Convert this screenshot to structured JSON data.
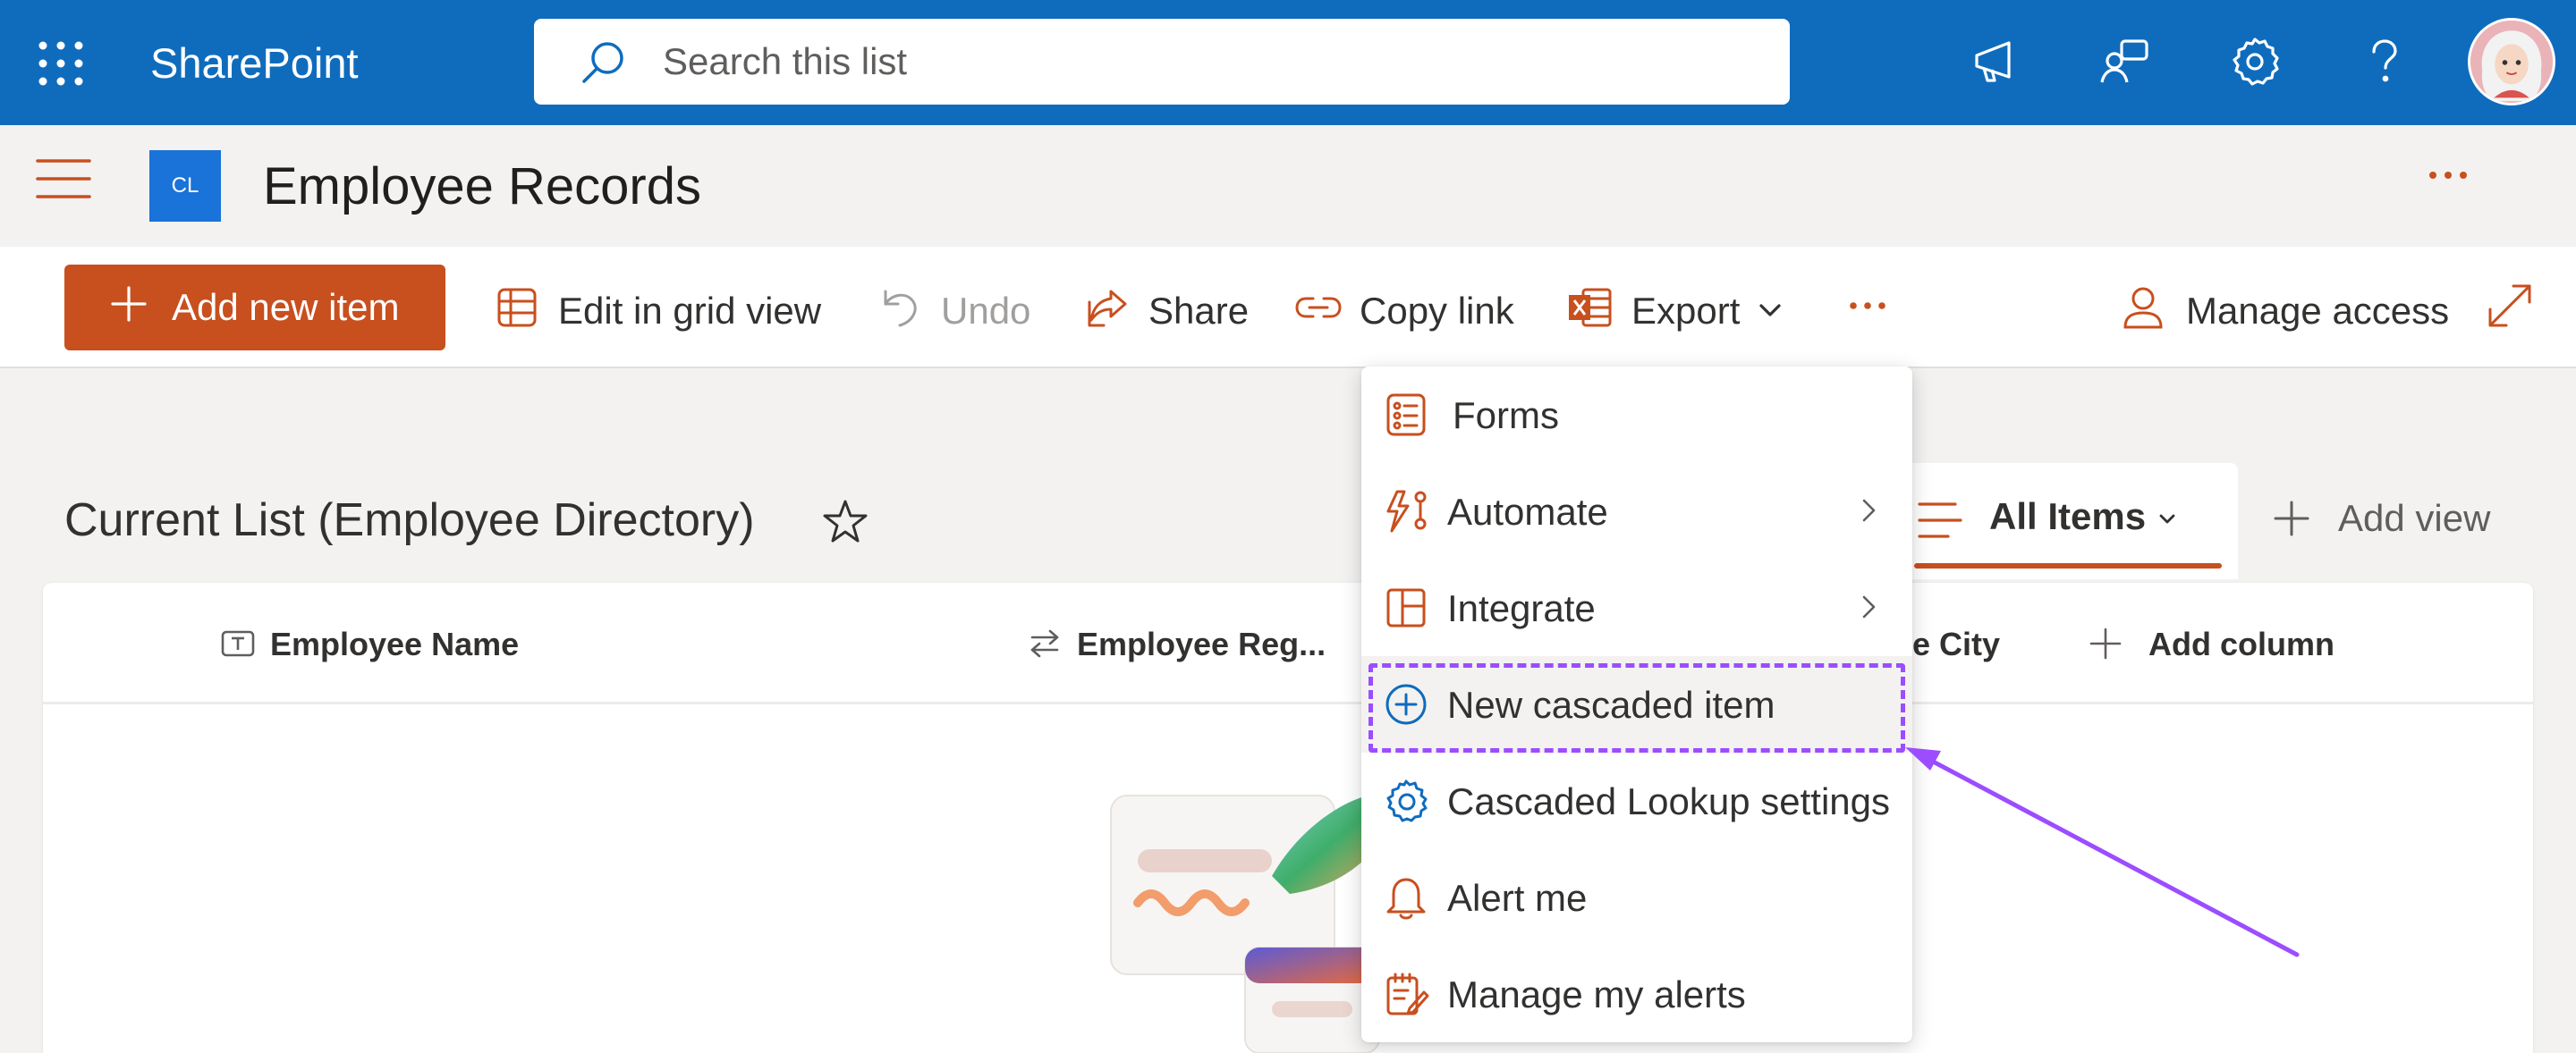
{
  "suite_bar": {
    "app_name": "SharePoint",
    "search": {
      "placeholder": "Search this list",
      "value": ""
    },
    "icons": [
      "waffle-icon",
      "megaphone-icon",
      "feedback-icon",
      "gear-icon",
      "help-icon"
    ],
    "color": "#0f6cbd"
  },
  "site": {
    "logo_initials": "CL",
    "title": "Employee Records"
  },
  "command_bar": {
    "add_new_item": "Add new item",
    "edit_grid": "Edit in grid view",
    "undo": "Undo",
    "share": "Share",
    "copy_link": "Copy link",
    "export": "Export",
    "manage_access": "Manage access",
    "accent_color": "#c84f1e"
  },
  "list": {
    "title": "Current List (Employee Directory)",
    "view_name": "All Items",
    "add_view": "Add view",
    "columns": [
      "Employee Name",
      "Employee Reg...",
      "e City",
      "Add column"
    ]
  },
  "menu": {
    "items": [
      {
        "label": "Forms",
        "icon": "forms-icon",
        "submenu": false
      },
      {
        "label": "Automate",
        "icon": "automate-icon",
        "submenu": true
      },
      {
        "label": "Integrate",
        "icon": "integrate-icon",
        "submenu": true
      },
      {
        "label": "New cascaded item",
        "icon": "add-circle-icon",
        "submenu": false,
        "highlighted": true
      },
      {
        "label": "Cascaded Lookup settings",
        "icon": "settings-icon",
        "submenu": false
      },
      {
        "label": "Alert me",
        "icon": "bell-icon",
        "submenu": false
      },
      {
        "label": "Manage my alerts",
        "icon": "manage-alerts-icon",
        "submenu": false
      }
    ],
    "highlight_color": "#9b4dff"
  }
}
